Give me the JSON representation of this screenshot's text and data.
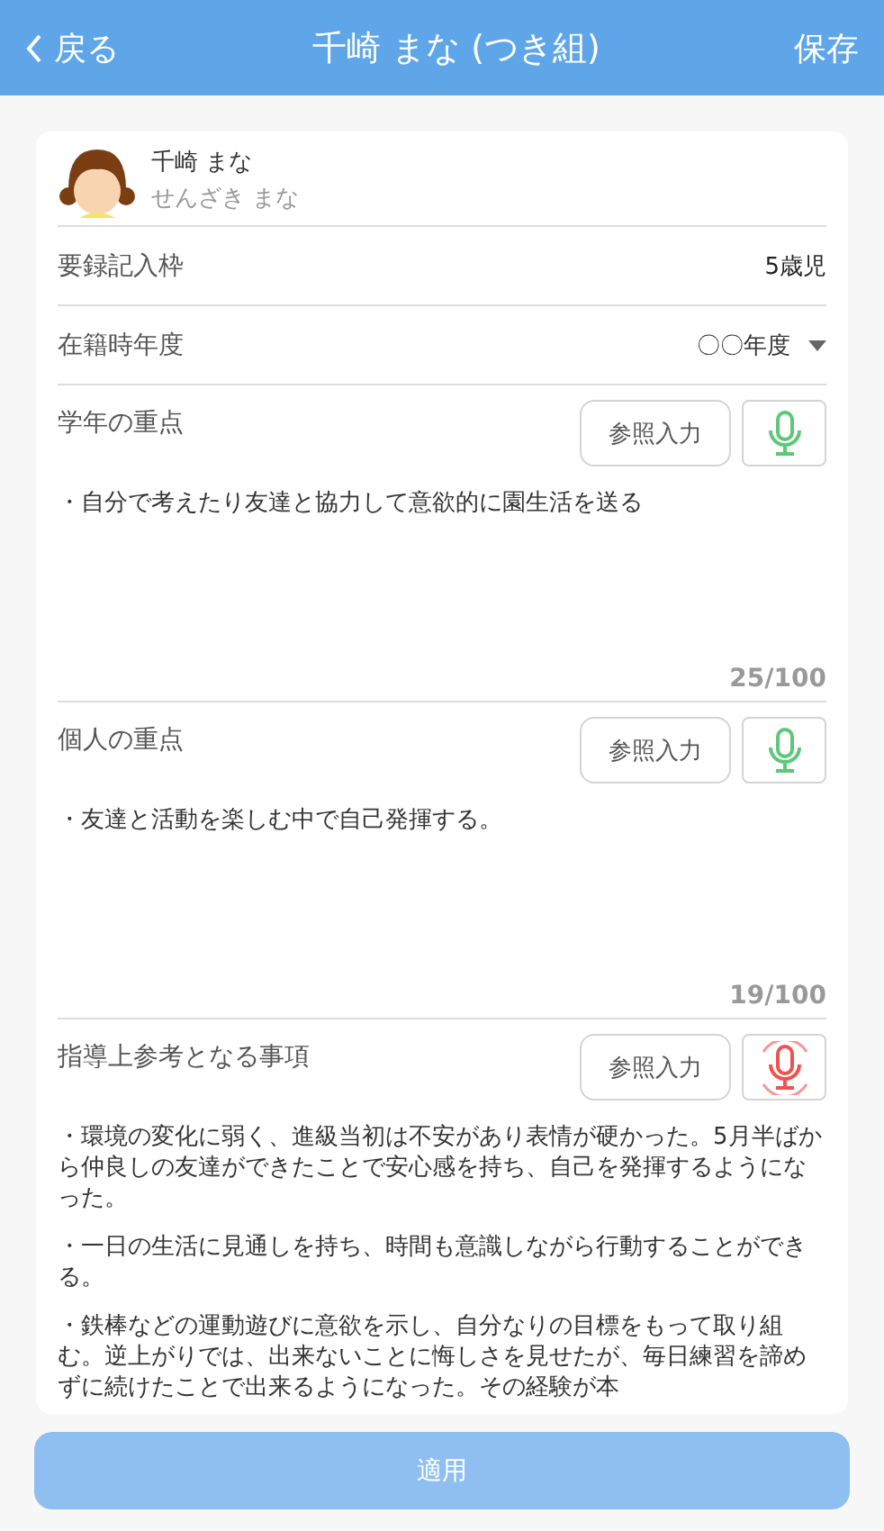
{
  "header": {
    "back": "戻る",
    "title": "千崎 まな (つき組)",
    "save": "保存"
  },
  "child": {
    "name": "千崎 まな",
    "kana": "せんざき まな"
  },
  "rows": [
    {
      "kind": "value",
      "label": "要録記入枠",
      "value": "5歳児"
    },
    {
      "kind": "select",
      "label": "在籍時年度",
      "value": "〇〇年度"
    }
  ],
  "sections": [
    {
      "label": "学年の重点",
      "reference_button": "参照入力",
      "recording": false,
      "paragraphs": [
        "・自分で考えたり友達と協力して意欲的に園生活を送る"
      ],
      "counter": "25/100"
    },
    {
      "label": "個人の重点",
      "reference_button": "参照入力",
      "recording": false,
      "paragraphs": [
        "・友達と活動を楽しむ中で自己発揮する。"
      ],
      "counter": "19/100"
    },
    {
      "label": "指導上参考となる事項",
      "reference_button": "参照入力",
      "recording": true,
      "paragraphs": [
        "・環境の変化に弱く、進級当初は不安があり表情が硬かった。5月半ばから仲良しの友達ができたことで安心感を持ち、自己を発揮するようになった。",
        "・一日の生活に見通しを持ち、時間も意識しながら行動することができる。",
        "・鉄棒などの運動遊びに意欲を示し、自分なりの目標をもって取り組む。逆上がりでは、出来ないことに悔しさを見せたが、毎日練習を諦めずに続けたことで出来るようになった。その経験が本"
      ]
    }
  ],
  "apply_button": {
    "label": "適用",
    "disabled": true
  }
}
